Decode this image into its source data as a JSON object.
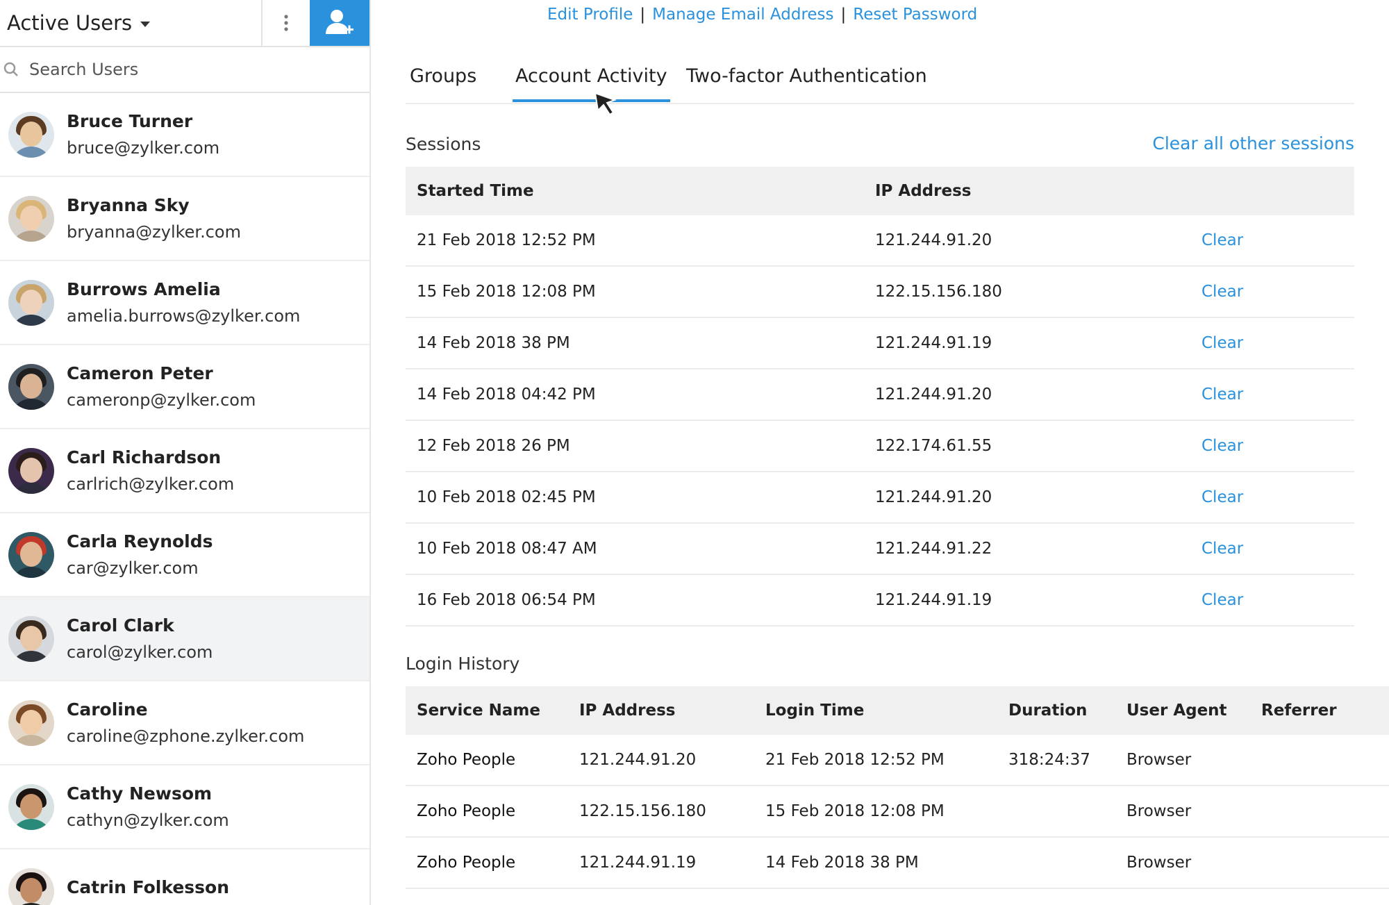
{
  "sidebar": {
    "title": "Active Users",
    "search_placeholder": "Search Users",
    "users": [
      {
        "name": "Bruce Turner",
        "email": "bruce@zylker.com"
      },
      {
        "name": "Bryanna Sky",
        "email": "bryanna@zylker.com"
      },
      {
        "name": "Burrows Amelia",
        "email": "amelia.burrows@zylker.com"
      },
      {
        "name": "Cameron Peter",
        "email": "cameronp@zylker.com"
      },
      {
        "name": "Carl Richardson",
        "email": "carlrich@zylker.com"
      },
      {
        "name": "Carla Reynolds",
        "email": "car@zylker.com"
      },
      {
        "name": "Carol Clark",
        "email": "carol@zylker.com"
      },
      {
        "name": "Caroline",
        "email": "caroline@zphone.zylker.com"
      },
      {
        "name": "Cathy Newsom",
        "email": "cathyn@zylker.com"
      },
      {
        "name": "Catrin Folkesson",
        "email": ""
      }
    ]
  },
  "top_links": {
    "edit_profile": "Edit Profile",
    "manage_email": "Manage Email Address",
    "reset_password": "Reset Password",
    "separator": "|"
  },
  "tabs": {
    "groups": "Groups",
    "account_activity": "Account Activity",
    "two_factor": "Two-factor Authentication"
  },
  "sessions": {
    "title": "Sessions",
    "clear_all": "Clear all other sessions",
    "headers": {
      "started": "Started Time",
      "ip": "IP Address"
    },
    "clear_label": "Clear",
    "rows": [
      {
        "started": "21 Feb 2018 12:52 PM",
        "ip": "121.244.91.20"
      },
      {
        "started": "15 Feb 2018 12:08 PM",
        "ip": "122.15.156.180"
      },
      {
        "started": "14 Feb 2018 38 PM",
        "ip": "121.244.91.19"
      },
      {
        "started": "14 Feb 2018 04:42 PM",
        "ip": "121.244.91.20"
      },
      {
        "started": "12 Feb 2018 26 PM",
        "ip": "122.174.61.55"
      },
      {
        "started": "10 Feb 2018 02:45 PM",
        "ip": "121.244.91.20"
      },
      {
        "started": "10 Feb 2018 08:47 AM",
        "ip": "121.244.91.22"
      },
      {
        "started": "16 Feb 2018 06:54 PM",
        "ip": "121.244.91.19"
      }
    ]
  },
  "login_history": {
    "title": "Login History",
    "headers": {
      "service": "Service Name",
      "ip": "IP Address",
      "login_time": "Login Time",
      "duration": "Duration",
      "agent": "User Agent",
      "referrer": "Referrer"
    },
    "rows": [
      {
        "service": "Zoho People",
        "ip": "121.244.91.20",
        "login_time": "21 Feb 2018 12:52 PM",
        "duration": "318:24:37",
        "agent": "Browser",
        "referrer": ""
      },
      {
        "service": "Zoho People",
        "ip": "122.15.156.180",
        "login_time": "15 Feb 2018 12:08 PM",
        "duration": "",
        "agent": "Browser",
        "referrer": ""
      },
      {
        "service": "Zoho People",
        "ip": "121.244.91.19",
        "login_time": "14 Feb 2018 38 PM",
        "duration": "",
        "agent": "Browser",
        "referrer": ""
      }
    ]
  },
  "colors": {
    "accent": "#2a91dd"
  },
  "icons": {
    "more": "vertical-dots-icon",
    "add_user": "add-user-icon",
    "search": "search-icon",
    "cursor": "mouse-pointer-icon"
  }
}
